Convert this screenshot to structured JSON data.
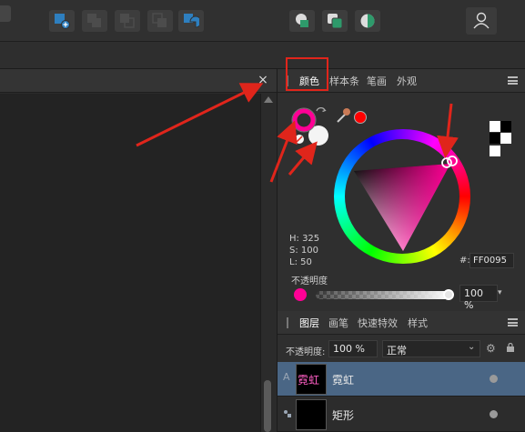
{
  "doc": {
    "close_glyph": "×"
  },
  "color_panel": {
    "tabs": [
      "颜色",
      "样本条",
      "笔画",
      "外观"
    ],
    "hsl": {
      "h": "H: 325",
      "s": "S: 100",
      "l": "L: 50"
    },
    "hex_label": "#:",
    "hex_value": "FF0095",
    "opacity_label": "不透明度",
    "opacity_value": "100 %",
    "current_color": "#ff0095",
    "opacity": 1.0
  },
  "layers_panel": {
    "tabs": [
      "图层",
      "画笔",
      "快速特效",
      "样式"
    ],
    "opacity_label": "不透明度:",
    "opacity_value": "100 %",
    "blend_mode": "正常",
    "layers": [
      {
        "type_letter": "A",
        "thumb_text": "霓虹",
        "name": "霓虹"
      },
      {
        "type_letter": "",
        "thumb_text": "",
        "name": "矩形"
      }
    ]
  },
  "icons": [
    "add-document-icon",
    "boolean-add-icon",
    "boolean-subtract-icon",
    "boolean-intersect-icon",
    "boolean-divide-icon",
    "shape-tool-icon",
    "user-icon",
    "eyedropper-icon",
    "swap-colors-icon",
    "settings-gear-icon",
    "lock-icon"
  ],
  "colors": {
    "accent": "#ff0095",
    "annotation": "#e0251b",
    "selected_row": "#4a6685",
    "button": "#2e7fbf"
  }
}
